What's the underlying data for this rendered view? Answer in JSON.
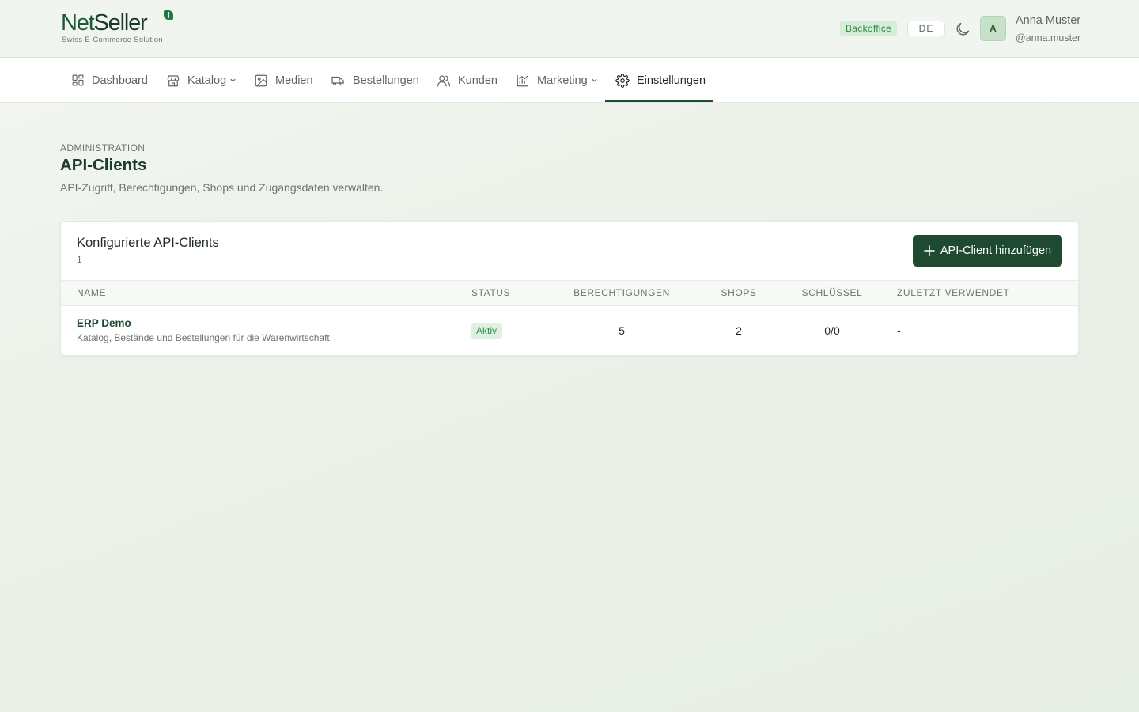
{
  "brand": {
    "name_part1": "Net",
    "name_part2": "Seller",
    "tagline": "Swiss E-Commerce Solution"
  },
  "header": {
    "badge": "Backoffice",
    "language": "DE",
    "avatar_initial": "A",
    "user_name": "Anna Muster",
    "user_handle": "@anna.muster"
  },
  "nav": {
    "items": [
      {
        "label": "Dashboard",
        "icon": "dashboard-icon"
      },
      {
        "label": "Katalog",
        "icon": "store-icon",
        "has_dropdown": true
      },
      {
        "label": "Medien",
        "icon": "image-icon"
      },
      {
        "label": "Bestellungen",
        "icon": "truck-icon"
      },
      {
        "label": "Kunden",
        "icon": "users-icon"
      },
      {
        "label": "Marketing",
        "icon": "chart-icon",
        "has_dropdown": true
      },
      {
        "label": "Einstellungen",
        "icon": "gear-icon",
        "active": true
      }
    ]
  },
  "page": {
    "eyebrow": "ADMINISTRATION",
    "title": "API-Clients",
    "subtitle": "API-Zugriff, Berechtigungen, Shops und Zugangsdaten verwalten."
  },
  "card": {
    "title": "Konfigurierte API-Clients",
    "count": "1",
    "add_button": "API-Client hinzufügen",
    "columns": [
      "NAME",
      "STATUS",
      "BERECHTIGUNGEN",
      "SHOPS",
      "SCHLÜSSEL",
      "ZULETZT VERWENDET"
    ],
    "rows": [
      {
        "name": "ERP Demo",
        "description": "Katalog, Bestände und Bestellungen für die Warenwirtschaft.",
        "status": "Aktiv",
        "permissions": "5",
        "shops": "2",
        "keys": "0/0",
        "last_used": "-"
      }
    ]
  },
  "colors": {
    "accent": "#1d4a30",
    "status_active_bg": "#def0df",
    "status_active_text": "#2f8f47"
  }
}
